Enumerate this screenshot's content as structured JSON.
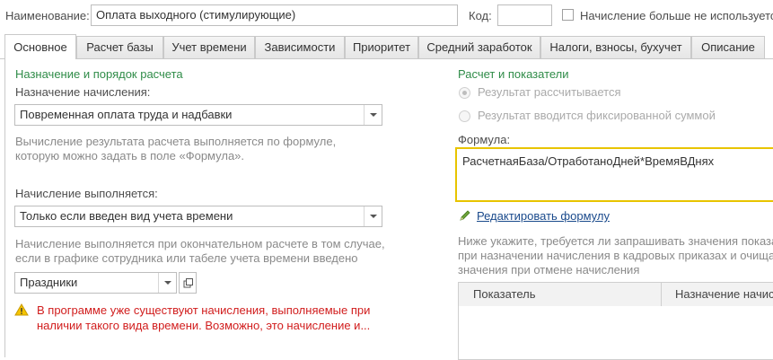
{
  "header": {
    "name_label": "Наименование:",
    "name_value": "Оплата выходного (стимулирующие)",
    "code_label": "Код:",
    "code_value": "",
    "not_used_label": "Начисление больше не используется"
  },
  "tabs": [
    {
      "label": "Основное",
      "active": true
    },
    {
      "label": "Расчет базы"
    },
    {
      "label": "Учет времени"
    },
    {
      "label": "Зависимости"
    },
    {
      "label": "Приоритет"
    },
    {
      "label": "Средний заработок"
    },
    {
      "label": "Налоги, взносы, бухучет"
    },
    {
      "label": "Описание"
    }
  ],
  "left": {
    "section_title": "Назначение и порядок расчета",
    "purpose_label": "Назначение начисления:",
    "purpose_value": "Повременная оплата труда и надбавки",
    "purpose_hint_1": "Вычисление результата расчета выполняется по формуле,",
    "purpose_hint_2": "которую можно задать в поле «Формула».",
    "performed_label": "Начисление выполняется:",
    "performed_value": "Только если введен вид учета времени",
    "performed_hint_1": "Начисление выполняется при окончательном расчете в том случае,",
    "performed_hint_2": "если в графике сотрудника или табеле учета времени введено",
    "time_kind_value": "Праздники",
    "warning_1": "В программе уже существуют начисления, выполняемые при",
    "warning_2": "наличии такого вида времени. Возможно, это начисление и..."
  },
  "right": {
    "section_title": "Расчет и показатели",
    "radio_calculated": "Результат рассчитывается",
    "radio_fixed": "Результат вводится фиксированной суммой",
    "formula_label": "Формула:",
    "formula_value": "РасчетнаяБаза/ОтработаноДней*ВремяВДнях",
    "edit_formula_link": "Редактировать формулу",
    "request_hint_1": "Ниже укажите, требуется ли запрашивать значения показа",
    "request_hint_2": "при назначении начисления в кадровых приказах и очища",
    "request_hint_3": "значения при отмене начисления",
    "table_columns": [
      "Показатель",
      "Назначение начисл"
    ]
  },
  "colors": {
    "section_green": "#2f8c48",
    "warning_red": "#d11d1d",
    "focus_yellow": "#e8c400",
    "link_blue": "#1a4a8c"
  },
  "icons": [
    "chevron-down-icon",
    "open-form-icon",
    "warning-icon",
    "pencil-icon"
  ]
}
